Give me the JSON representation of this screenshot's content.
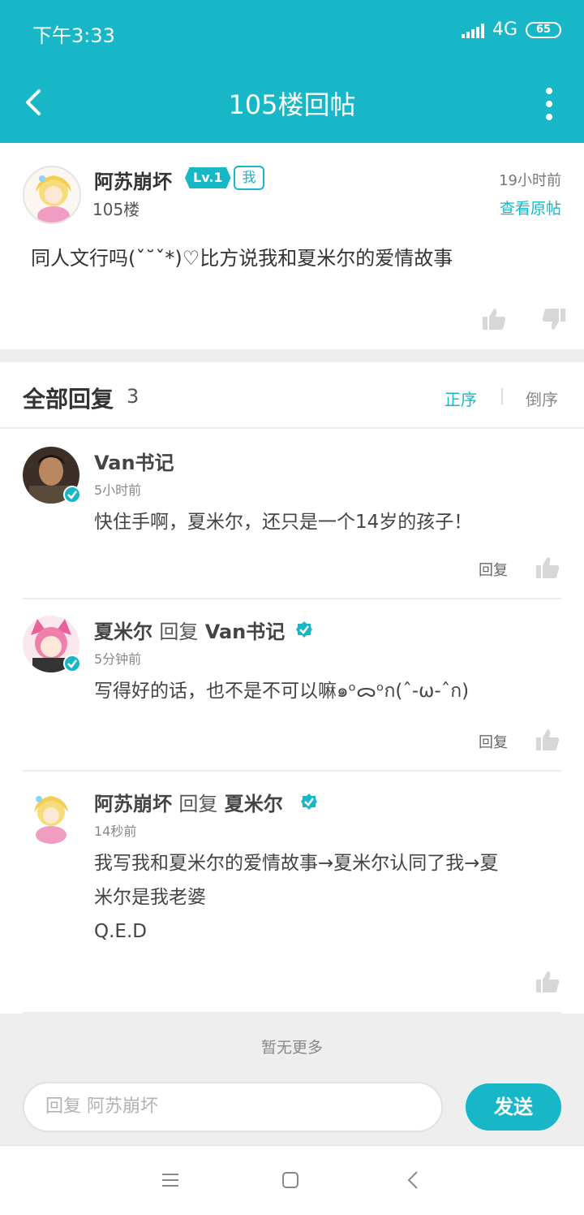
{
  "status_bar": {
    "time": "下午3:33",
    "network": "4G",
    "battery": "65"
  },
  "header": {
    "title": "105楼回帖"
  },
  "post": {
    "author": "阿苏崩坏",
    "level": "Lv.1",
    "me_badge": "我",
    "floor": "105楼",
    "time": "19小时前",
    "view_original": "查看原帖",
    "content": "同人文行吗(ˇ˘ˇ*)♡比方说我和夏米尔的爱情故事"
  },
  "replies_header": {
    "label": "全部回复",
    "count": "3",
    "sort_asc": "正序",
    "sort_desc": "倒序"
  },
  "replies": [
    {
      "name": "Van书记",
      "reply_word": "",
      "reply_to": "",
      "time": "5小时前",
      "text": "快住手啊，夏米尔，还只是一个14岁的孩子！",
      "reply_button": "回复"
    },
    {
      "name": "夏米尔",
      "reply_word": "回复",
      "reply_to": "Van书记",
      "time": "5分钟前",
      "text": "写得好的话，也不是不可以嘛๑ᵒᯅᵒก(ˆ-ω-ˆก)",
      "reply_button": "回复"
    },
    {
      "name": "阿苏崩坏",
      "reply_word": "回复",
      "reply_to": "夏米尔",
      "time": "14秒前",
      "text_lines": [
        "我写我和夏米尔的爱情故事→夏米尔认同了我→夏",
        "米尔是我老婆",
        "Q.E.D"
      ]
    }
  ],
  "footer": {
    "no_more": "暂无更多",
    "input_placeholder": "回复 阿苏崩坏",
    "send_label": "发送"
  },
  "colors": {
    "accent": "#17b7c8",
    "background_gray": "#eeeeee"
  }
}
